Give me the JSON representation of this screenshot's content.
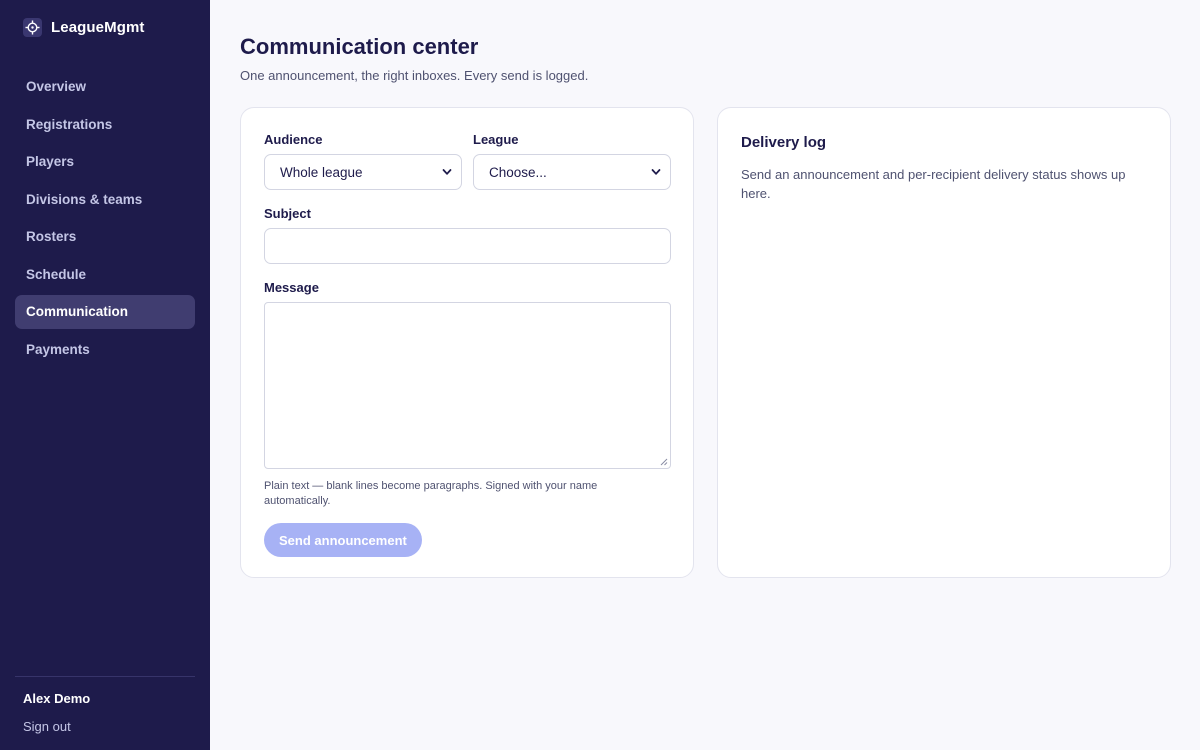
{
  "app": {
    "brand_name": "LeagueMgmt",
    "brand_icon": "crosshair-icon"
  },
  "sidebar": {
    "items": [
      {
        "label": "Overview"
      },
      {
        "label": "Registrations"
      },
      {
        "label": "Players"
      },
      {
        "label": "Divisions & teams"
      },
      {
        "label": "Rosters"
      },
      {
        "label": "Schedule"
      },
      {
        "label": "Communication",
        "active": true
      },
      {
        "label": "Payments"
      }
    ],
    "user_name": "Alex Demo",
    "sign_out": "Sign out"
  },
  "page": {
    "title": "Communication center",
    "subtitle": "One announcement, the right inboxes. Every send is logged."
  },
  "compose": {
    "audience_label": "Audience",
    "audience_value": "Whole league",
    "league_label": "League",
    "league_value": "Choose...",
    "subject_label": "Subject",
    "subject_value": "",
    "message_label": "Message",
    "message_value": "",
    "hint": "Plain text — blank lines become paragraphs. Signed with your name automatically.",
    "send_label": "Send announcement"
  },
  "log": {
    "title": "Delivery log",
    "empty_text": "Send an announcement and per-recipient delivery status shows up here."
  },
  "colors": {
    "sidebar_bg": "#1e1b4b",
    "active_nav_bg": "#403d70",
    "send_button_disabled": "#a7b2f5",
    "page_bg": "#f8f8fc"
  }
}
